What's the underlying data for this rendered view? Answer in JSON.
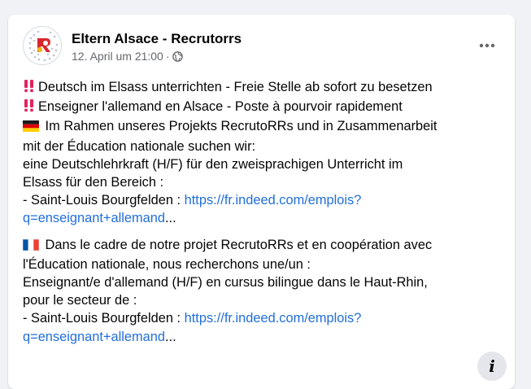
{
  "post": {
    "author": "Eltern Alsace - Recrutorrs",
    "timestamp": "12. April um 21:00",
    "separator": "·",
    "audience_icon": "globe-icon",
    "more_icon": "more-options-icon"
  },
  "content": {
    "de": {
      "line1_emoji": "double-exclamation-icon",
      "line1": "Deutsch im Elsass unterrichten - Freie Stelle ab sofort zu besetzen",
      "line2_emoji": "double-exclamation-icon",
      "line2": "Enseigner l'allemand en Alsace - Poste à pourvoir rapidement",
      "flag": "flag-germany-icon",
      "line3": " Im Rahmen unseres Projekts RecrutoRRs und in Zusammenarbeit",
      "line4": "mit der Éducation nationale suchen wir:",
      "line5": "eine Deutschlehrkraft (H/F) für den zweisprachigen Unterricht im",
      "line6": "Elsass für den Bereich :",
      "line7_prefix": "- Saint-Louis Bourgfelden  : ",
      "link_part1": "https://fr.indeed.com/emplois?",
      "link_part2": "q=enseignant+allemand",
      "ellipsis": "..."
    },
    "fr": {
      "flag": "flag-france-icon",
      "line1": " Dans le cadre de notre projet RecrutoRRs et en coopération avec",
      "line2": "l'Éducation nationale, nous recherchons une/un :",
      "line3": "Enseignant/e d'allemand (H/F) en cursus bilingue dans le Haut-Rhin,",
      "line4": "pour le secteur de :",
      "line5_prefix": "- Saint-Louis Bourgfelden : ",
      "link_part1": "https://fr.indeed.com/emplois?",
      "link_part2": "q=enseignant+allemand",
      "ellipsis": "..."
    }
  },
  "info_button": {
    "label": "i",
    "icon": "info-icon"
  },
  "colors": {
    "page_bg": "#f0f2f5",
    "card_bg": "#ffffff",
    "link": "#216fdb",
    "secondary_text": "#65676b",
    "exclamation": "#e0245e"
  }
}
